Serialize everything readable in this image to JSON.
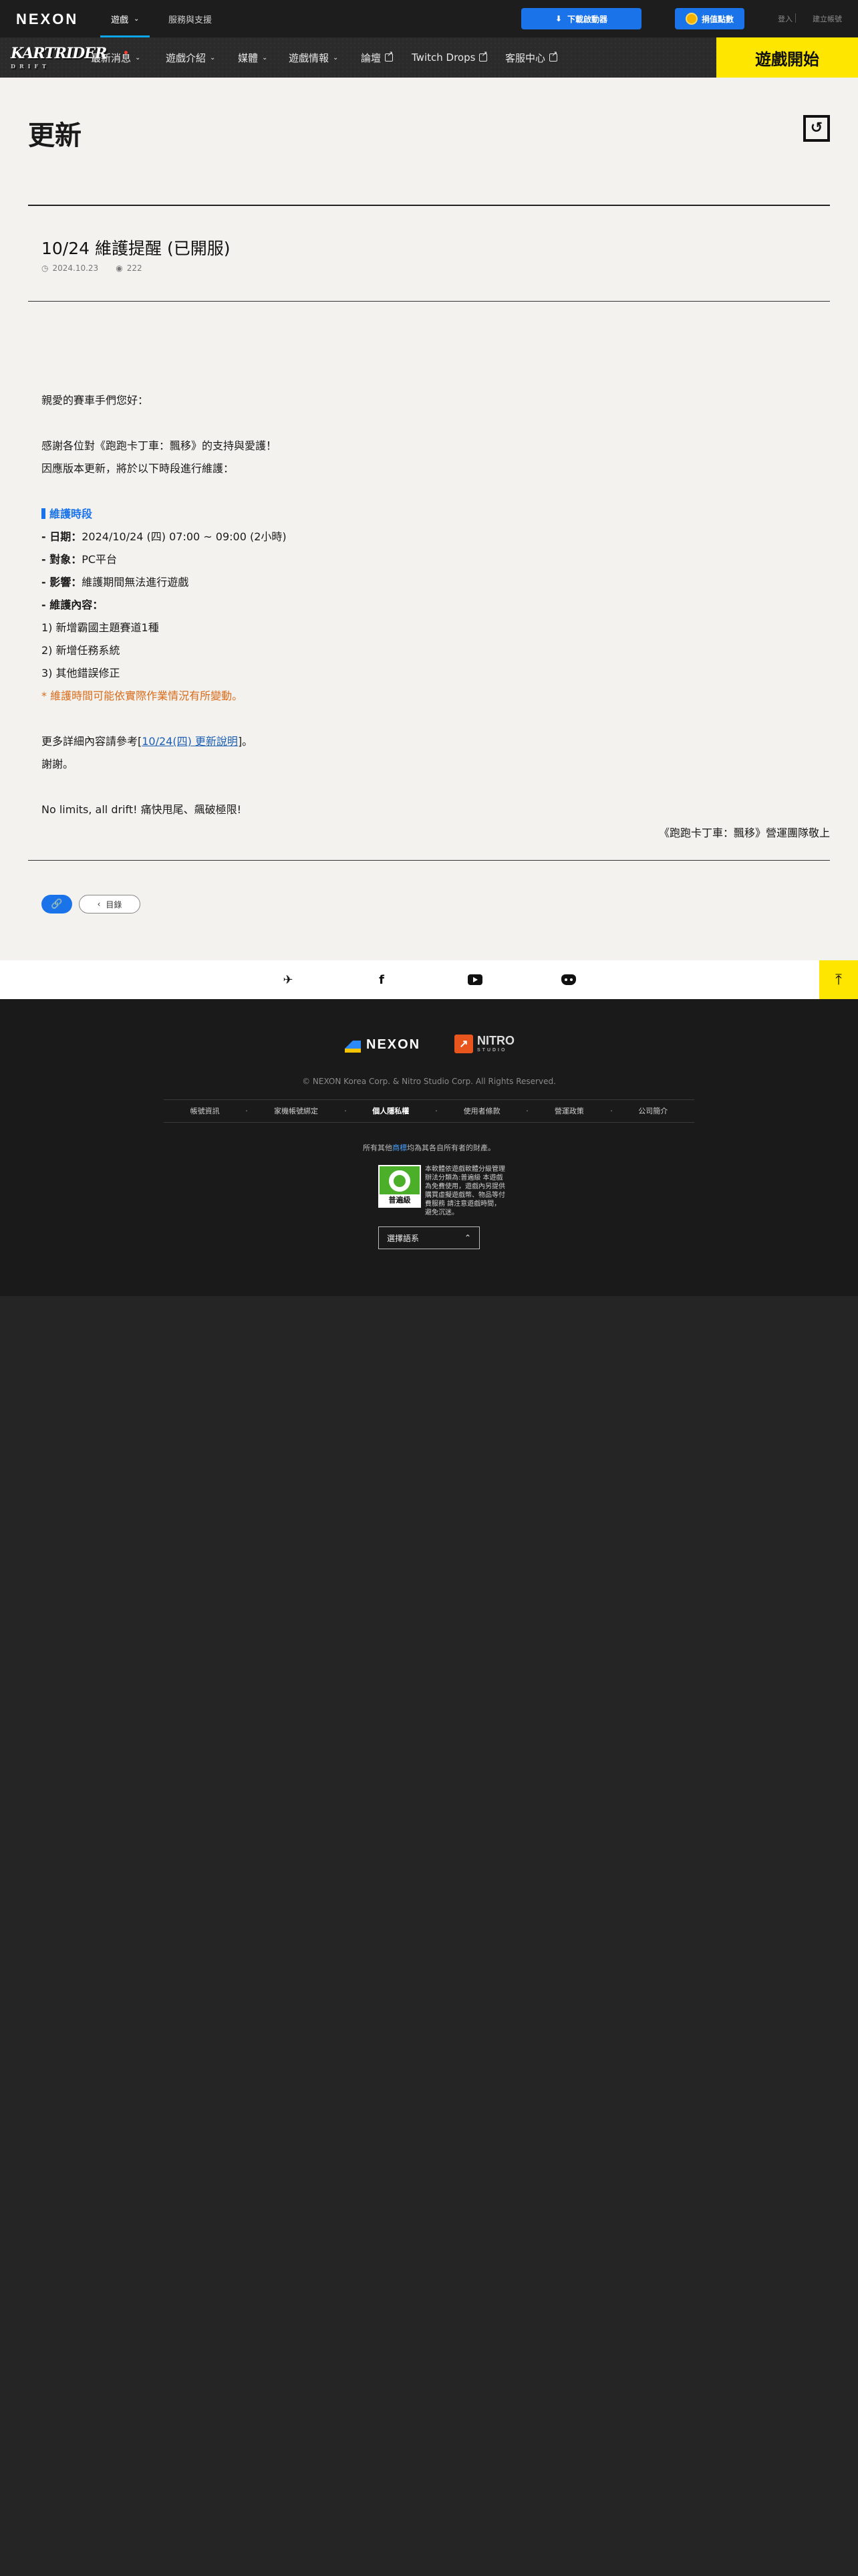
{
  "topbar": {
    "logo": "NEXON",
    "tabs": [
      {
        "label": "遊戲",
        "active": true
      },
      {
        "label": "服務與支援",
        "active": false
      }
    ],
    "download_label": "下載啟動器",
    "points_label": "捐值點數",
    "login_label": "登入",
    "register_label": "建立帳號"
  },
  "gamenav": {
    "logo_text": "KARTRIDER",
    "logo_sub": "DRIFT",
    "items": [
      {
        "label": "最新消息"
      },
      {
        "label": "遊戲介紹"
      },
      {
        "label": "媒體"
      },
      {
        "label": "遊戲情報"
      },
      {
        "label": "論壇"
      },
      {
        "label": "Twitch Drops"
      },
      {
        "label": "客服中心"
      }
    ],
    "start_label": "遊戲開始"
  },
  "page": {
    "title": "更新",
    "back_icon": "return-icon"
  },
  "post": {
    "title": "10/24 維護提醒 (已開服)",
    "date": "2024.10.23",
    "views": "222",
    "greeting": "親愛的賽車手們您好：",
    "thanks": "感謝各位對《跑跑卡丁車：飄移》的支持與愛護！",
    "intro": "因應版本更新，將於以下時段進行維護：",
    "section_heading": "維護時段",
    "date_label": "- 日期：",
    "date_value": "2024/10/24 (四) 07:00 ~ 09:00 (2小時)",
    "target_label": "- 對象：",
    "target_value": "PC平台",
    "impact_label": "- 影響：",
    "impact_value": "維護期間無法進行遊戲",
    "content_label": "- 維護內容：",
    "content_items": [
      "1) 新增霸國主題賽道1種",
      "2) 新增任務系統",
      "3) 其他錯誤修正"
    ],
    "note": "* 維護時間可能依實際作業情況有所變動。",
    "more_prefix": "更多詳細內容請參考[",
    "more_link": "10/24(四) 更新說明",
    "more_suffix": "]。",
    "thank_you": "謝謝。",
    "slogan": "No limits, all drift! 痛快甩尾、飆破極限!",
    "signoff": "《跑跑卡丁車：飄移》營運團隊敬上"
  },
  "actions": {
    "link_icon": "link-icon",
    "list_label": "目錄"
  },
  "social": {
    "icons": [
      "kartrider-icon",
      "facebook-icon",
      "youtube-icon",
      "discord-icon"
    ],
    "to_top_icon": "arrow-up-icon"
  },
  "footer": {
    "nexon_logo": "NEXON",
    "nitro_logo": "NITRO",
    "nitro_sub": "STUDIO",
    "copyright": "© NEXON Korea Corp. & Nitro Studio Corp. All Rights Reserved.",
    "links": [
      {
        "label": "帳號資訊",
        "bold": false
      },
      {
        "label": "家機帳號綁定",
        "bold": false
      },
      {
        "label": "個人隱私權",
        "bold": true
      },
      {
        "label": "使用者條款",
        "bold": false
      },
      {
        "label": "營運政策",
        "bold": false
      },
      {
        "label": "公司簡介",
        "bold": false
      }
    ],
    "trademark_prefix": "所有其他",
    "trademark_link": "商標",
    "trademark_suffix": "均為其各自所有者的財產。",
    "rating_label": "普遍級",
    "rating_text": "本軟體依遊戲軟體分級管理辦法分類為:普遍級 本遊戲為免費使用，遊戲內另提供購買虛擬遊戲幣、物品等付費服務 請注意遊戲時間，避免沉迷。",
    "language_label": "選擇語系"
  }
}
